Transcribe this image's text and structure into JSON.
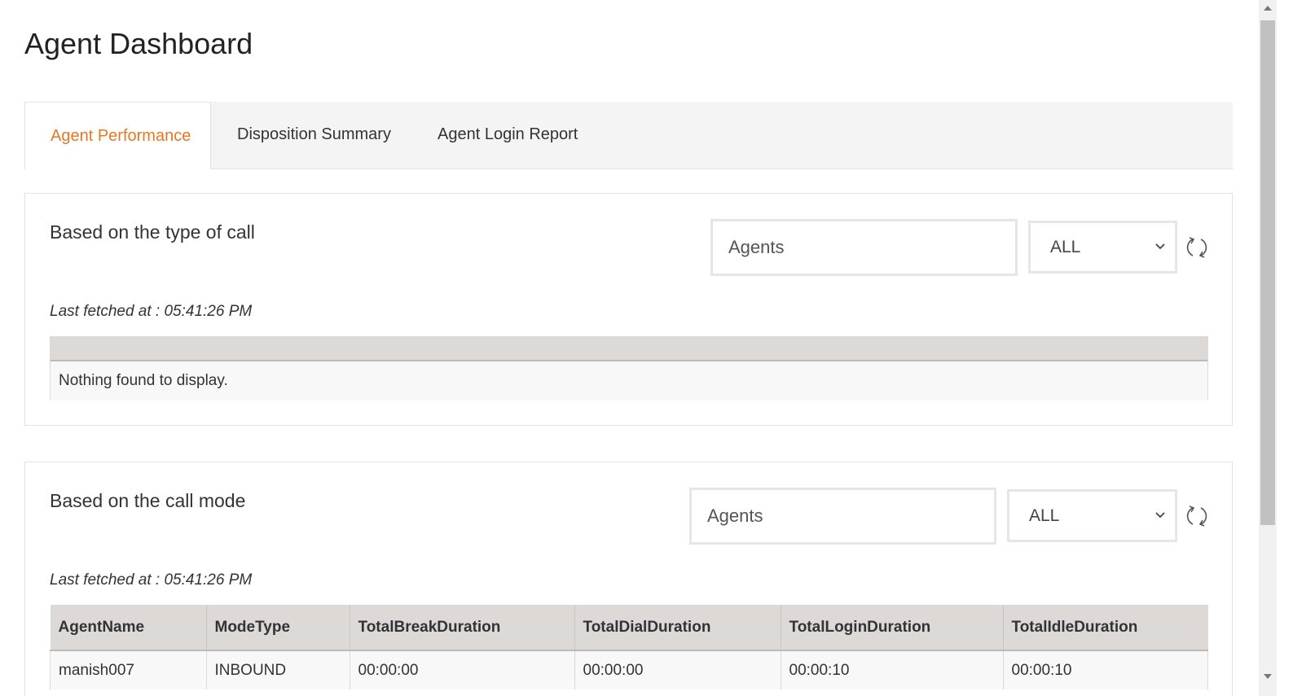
{
  "page": {
    "title": "Agent Dashboard"
  },
  "tabs": [
    {
      "label": "Agent Performance",
      "active": true
    },
    {
      "label": "Disposition Summary",
      "active": false
    },
    {
      "label": "Agent Login Report",
      "active": false
    }
  ],
  "panels": {
    "call_type": {
      "title": "Based on the type of call",
      "agents_placeholder": "Agents",
      "filter_value": "ALL",
      "last_fetched": "Last fetched at : 05:41:26 PM",
      "empty_message": "Nothing found to display."
    },
    "call_mode": {
      "title": "Based on the call mode",
      "agents_placeholder": "Agents",
      "filter_value": "ALL",
      "last_fetched": "Last fetched at : 05:41:26 PM",
      "columns": [
        "AgentName",
        "ModeType",
        "TotalBreakDuration",
        "TotalDialDuration",
        "TotalLoginDuration",
        "TotalIdleDuration"
      ],
      "rows": [
        [
          "manish007",
          "INBOUND",
          "00:00:00",
          "00:00:00",
          "00:00:10",
          "00:00:10"
        ]
      ]
    }
  },
  "colors": {
    "accent": "#e87722",
    "header_bg": "#dcd9d7",
    "tabbar_bg": "#f4f4f4"
  },
  "icons": {
    "refresh": "refresh-icon",
    "dropdown": "chevron-down-icon"
  }
}
